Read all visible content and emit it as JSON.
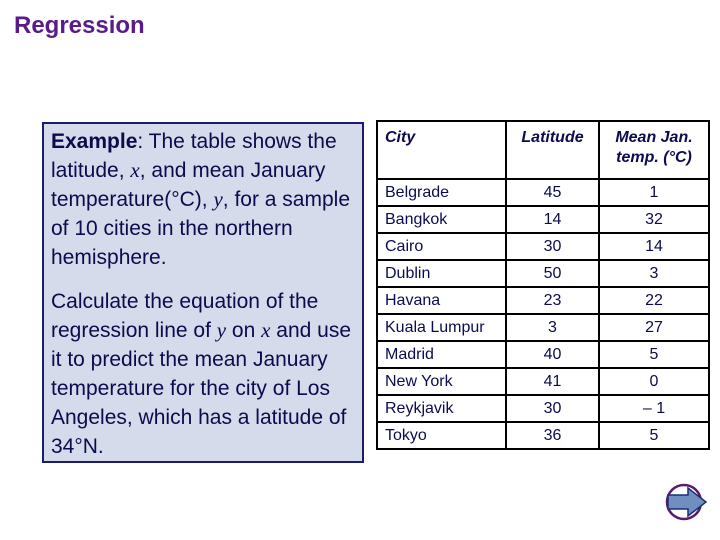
{
  "title": "Regression",
  "example": {
    "label": "Example",
    "p1_a": ": The table shows the latitude, ",
    "var_x": "x",
    "p1_b": ", and mean January temperature(°C), ",
    "var_y": "y",
    "p1_c": ", for a sample of 10 cities in the northern hemisphere.",
    "p2_a": "Calculate the equation of the regression line of ",
    "p2_var_y": "y",
    "p2_b": " on ",
    "p2_var_x": "x",
    "p2_c": " and use it to predict the mean January temperature for the city of Los Angeles, which has a latitude of 34°N."
  },
  "table": {
    "headers": [
      "City",
      "Latitude",
      "Mean Jan. temp. (°C)"
    ],
    "rows": [
      [
        "Belgrade",
        "45",
        "1"
      ],
      [
        "Bangkok",
        "14",
        "32"
      ],
      [
        "Cairo",
        "30",
        "14"
      ],
      [
        "Dublin",
        "50",
        "3"
      ],
      [
        "Havana",
        "23",
        "22"
      ],
      [
        "Kuala Lumpur",
        "3",
        "27"
      ],
      [
        "Madrid",
        "40",
        "5"
      ],
      [
        "New York",
        "41",
        "0"
      ],
      [
        "Reykjavik",
        "30",
        "– 1"
      ],
      [
        "Tokyo",
        "36",
        "5"
      ]
    ]
  },
  "nav": {
    "icon": "next-arrow-icon"
  }
}
